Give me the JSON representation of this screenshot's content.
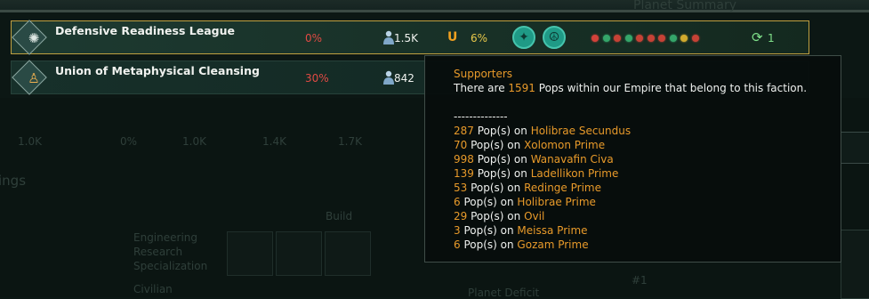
{
  "factions": [
    {
      "name": "Defensive Readiness League",
      "approval": "0%",
      "pops": "1.5K",
      "influence": "6%",
      "ethics": [
        "militarist-icon",
        "pacifist-icon"
      ],
      "supporters_change": "1",
      "dot_colors": [
        "#d2423a",
        "#35a66a",
        "#c64236",
        "#35a66a",
        "#c64236",
        "#c64236",
        "#c64236",
        "#35a66a",
        "#d1aa2e",
        "#c64236"
      ]
    },
    {
      "name": "Union of Metaphysical Cleansing",
      "approval": "30%",
      "pops": "842"
    }
  ],
  "background": {
    "top_text": "Planet Summary",
    "ghost_values": [
      "1.0K",
      "0%",
      "1.0K",
      "1.4K",
      "1.7K"
    ],
    "build_label": "Build",
    "section_heading": "ings",
    "engineering": [
      "Engineering",
      "Research",
      "Specialization"
    ],
    "civilian": "Civilian",
    "planet_deficit": "Planet Deficit",
    "right_marker": "#1"
  },
  "tooltip": {
    "title": "Supporters",
    "intro_prefix": "There are ",
    "intro_count": "1591",
    "intro_suffix": " Pops within our Empire that belong to this faction.",
    "separator": "--------------",
    "pop_label": " Pop(s) on ",
    "entries": [
      {
        "count": "287",
        "planet": "Holibrae Secundus"
      },
      {
        "count": "70",
        "planet": "Xolomon Prime"
      },
      {
        "count": "998",
        "planet": "Wanavafin Civa"
      },
      {
        "count": "139",
        "planet": "Ladellikon Prime"
      },
      {
        "count": "53",
        "planet": "Redinge Prime"
      },
      {
        "count": "6",
        "planet": "Holibrae Prime"
      },
      {
        "count": "29",
        "planet": "Ovil"
      },
      {
        "count": "3",
        "planet": "Meissa Prime"
      },
      {
        "count": "6",
        "planet": "Gozam Prime"
      }
    ]
  }
}
